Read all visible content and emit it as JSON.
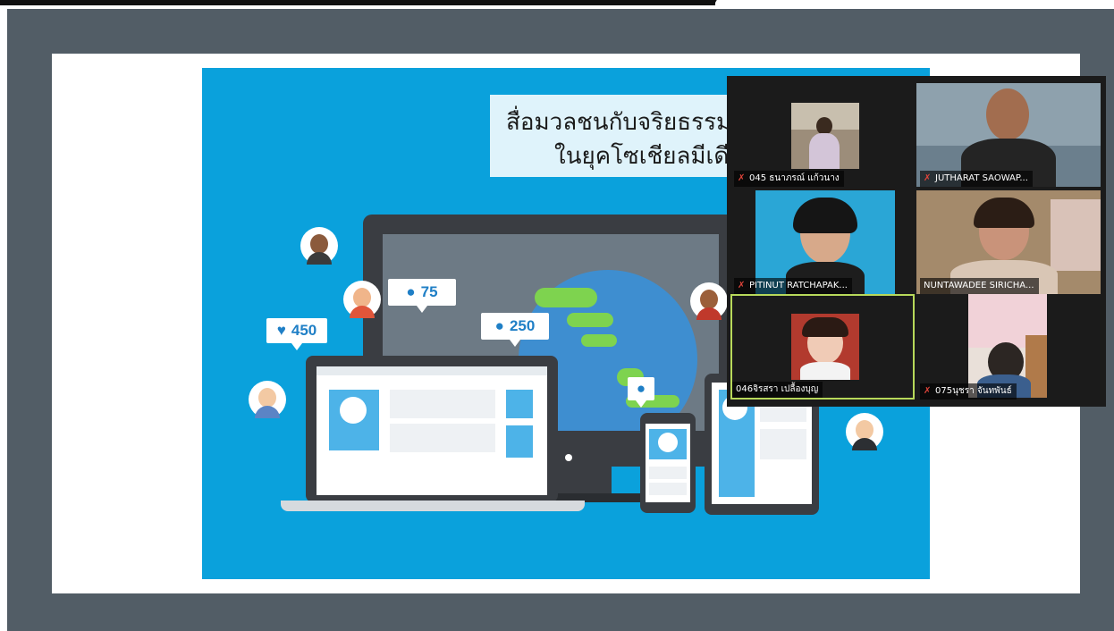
{
  "slide": {
    "title_line1": "สื่อมวลชนกับจริยธรรม",
    "title_line2": "ในยุคโซเชียลมีเดีย",
    "stat_likes": "450",
    "stat_followers": "75",
    "stat_comments": "250"
  },
  "participants": [
    {
      "name": "045 ธนาภรณ์ แก้วนาง",
      "muted": true
    },
    {
      "name": "JUTHARAT SAOWAP...",
      "muted": true
    },
    {
      "name": "PITINUT RATCHAPAK...",
      "muted": true
    },
    {
      "name": "NUNTAWADEE SIRICHA...",
      "muted": false
    },
    {
      "name": "046จิรสรา เปลื้องบุญ",
      "muted": false,
      "active_speaker": true
    },
    {
      "name": "075นุชรา จันทพันธ์",
      "muted": true
    }
  ],
  "icons": {
    "mute": "muted-mic-icon",
    "heart": "heart-icon",
    "user": "user-icon",
    "chat": "chat-bubble-icon"
  },
  "colors": {
    "slide_bg": "#0aa1dc",
    "active_speaker": "#b8d95a",
    "stage_bg": "#525d66"
  }
}
